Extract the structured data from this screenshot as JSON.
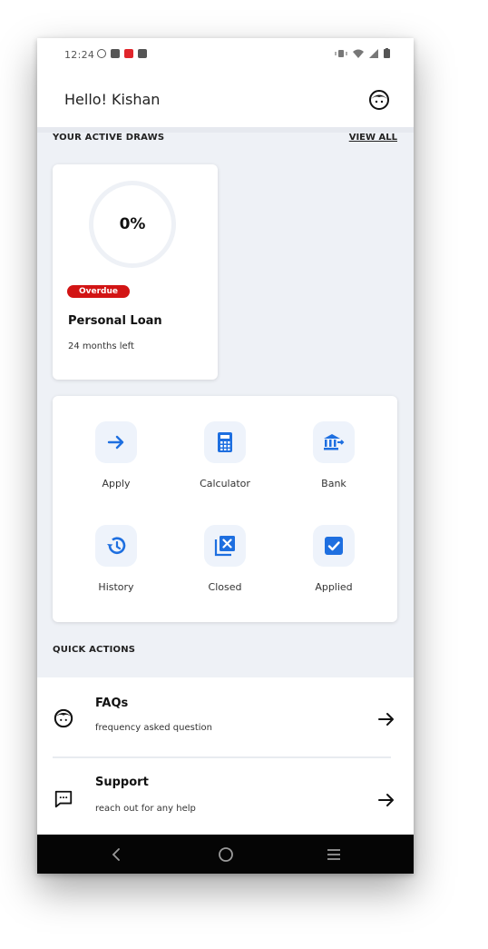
{
  "status_bar": {
    "time": "12:24"
  },
  "header": {
    "greeting": "Hello! Kishan"
  },
  "active_draws": {
    "section_title": "YOUR ACTIVE DRAWS",
    "view_all_label": "VIEW ALL",
    "card": {
      "progress_label": "0%",
      "progress_value": 0,
      "status_badge": "Overdue",
      "title": "Personal Loan",
      "subtitle": "24 months left"
    }
  },
  "menu": {
    "items": [
      {
        "label": "Apply",
        "icon": "arrow-right-icon"
      },
      {
        "label": "Calculator",
        "icon": "calculator-icon"
      },
      {
        "label": "Bank",
        "icon": "bank-icon"
      },
      {
        "label": "History",
        "icon": "history-icon"
      },
      {
        "label": "Closed",
        "icon": "closed-box-icon"
      },
      {
        "label": "Applied",
        "icon": "checkbox-icon"
      }
    ]
  },
  "quick_actions": {
    "section_title": "QUICK ACTIONS",
    "items": [
      {
        "title": "FAQs",
        "subtitle": "frequency asked question",
        "icon": "faq-icon"
      },
      {
        "title": "Support",
        "subtitle": "reach out for any help",
        "icon": "chat-icon"
      }
    ]
  },
  "colors": {
    "accent_blue": "#1e6fe0",
    "badge_red": "#d21414",
    "background": "#eef1f6"
  }
}
